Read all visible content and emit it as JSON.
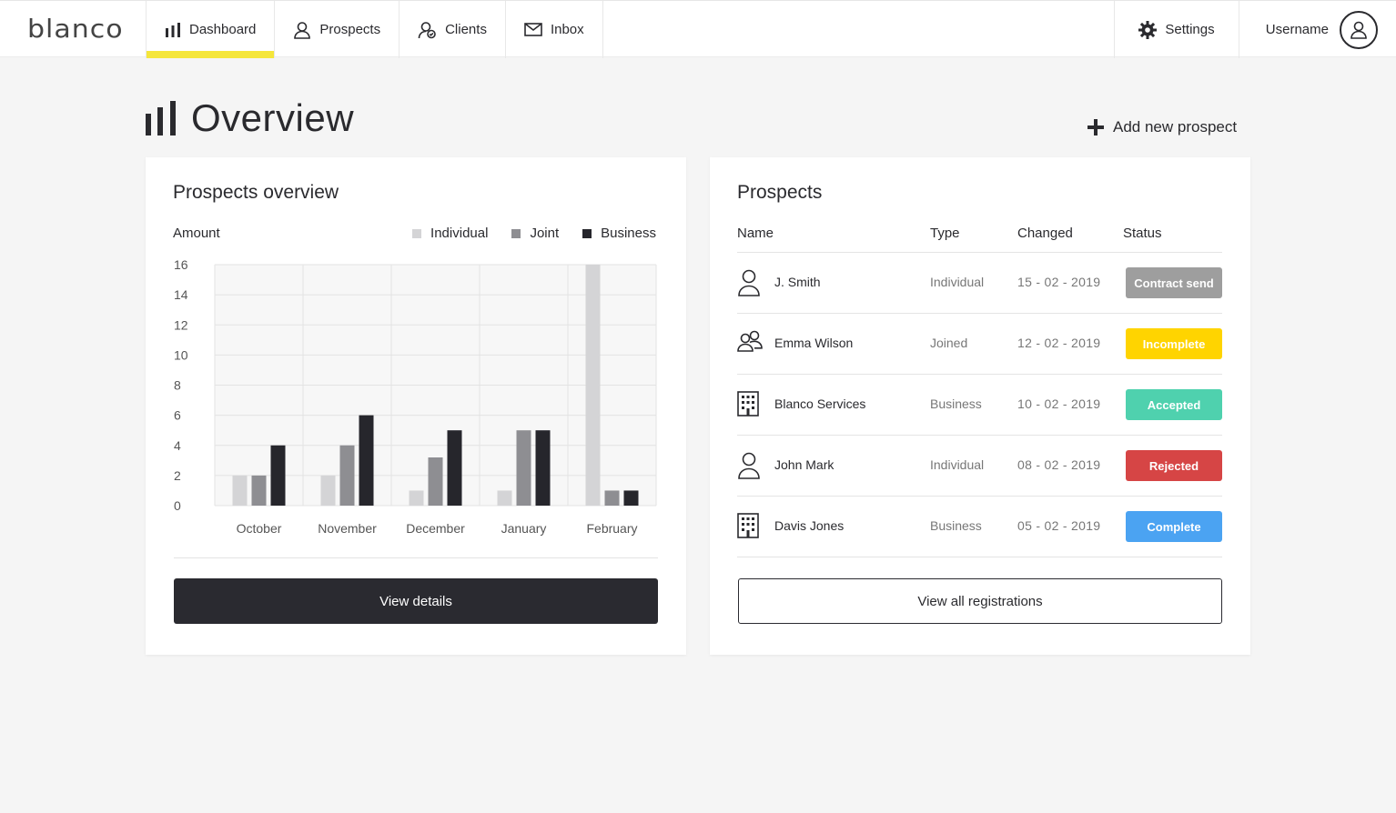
{
  "app": {
    "logo": "blanco"
  },
  "nav": {
    "items": [
      {
        "label": "Dashboard",
        "icon": "bar-chart-icon",
        "active": true
      },
      {
        "label": "Prospects",
        "icon": "person-icon"
      },
      {
        "label": "Clients",
        "icon": "client-check-icon"
      },
      {
        "label": "Inbox",
        "icon": "envelope-icon"
      }
    ],
    "settings_label": "Settings",
    "username": "Username"
  },
  "page": {
    "title": "Overview",
    "add_prospect_label": "Add new prospect"
  },
  "overview_card": {
    "title": "Prospects overview",
    "view_details_label": "View details"
  },
  "chart_data": {
    "type": "bar",
    "ylabel": "Amount",
    "ylim": [
      0,
      16
    ],
    "yticks": [
      0,
      2,
      4,
      6,
      8,
      10,
      12,
      14,
      16
    ],
    "categories": [
      "October",
      "November",
      "December",
      "January",
      "February"
    ],
    "series": [
      {
        "name": "Individual",
        "color": "#d4d4d6",
        "values": [
          2,
          2,
          1,
          1,
          16
        ]
      },
      {
        "name": "Joint",
        "color": "#8e8e92",
        "values": [
          2,
          4,
          3.2,
          5,
          1
        ]
      },
      {
        "name": "Business",
        "color": "#26262c",
        "values": [
          4,
          6,
          5,
          5,
          1
        ]
      }
    ],
    "grid": true,
    "legend": "top-right"
  },
  "prospects_card": {
    "title": "Prospects",
    "columns": [
      "Name",
      "Type",
      "Changed",
      "Status"
    ],
    "rows": [
      {
        "name": "J. Smith",
        "type": "Individual",
        "changed": "15 - 02 - 2019",
        "status": "Contract send",
        "status_color": "#9e9e9e",
        "icon": "person-icon"
      },
      {
        "name": "Emma Wilson",
        "type": "Joined",
        "changed": "12 - 02 - 2019",
        "status": "Incomplete",
        "status_color": "#ffd400",
        "icon": "two-people-icon"
      },
      {
        "name": "Blanco Services",
        "type": "Business",
        "changed": "10 - 02 - 2019",
        "status": "Accepted",
        "status_color": "#4fd1ae",
        "icon": "building-icon"
      },
      {
        "name": "John Mark",
        "type": "Individual",
        "changed": "08 - 02 - 2019",
        "status": "Rejected",
        "status_color": "#d64545",
        "icon": "person-icon"
      },
      {
        "name": "Davis Jones",
        "type": "Business",
        "changed": "05 - 02 - 2019",
        "status": "Complete",
        "status_color": "#4ba3f2",
        "icon": "building-icon"
      }
    ],
    "view_all_label": "View all registrations"
  }
}
